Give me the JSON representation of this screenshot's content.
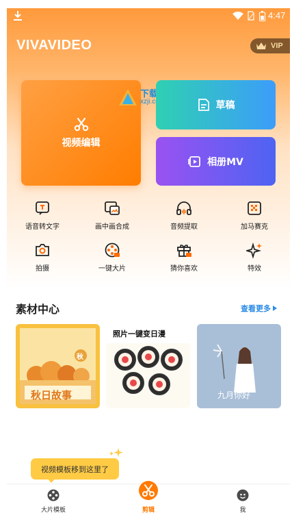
{
  "status_bar": {
    "time": "4:47"
  },
  "header": {
    "app_title": "VIVAVIDEO",
    "vip_label": "VIP"
  },
  "cards": {
    "edit_label": "视频编辑",
    "draft_label": "草稿",
    "mv_label": "相册MV"
  },
  "watermark": {
    "title": "下载集",
    "url": "xzji.com"
  },
  "tools": [
    {
      "label": "语音转文字",
      "icon": "speech-to-text-icon"
    },
    {
      "label": "画中画合成",
      "icon": "picture-in-picture-icon"
    },
    {
      "label": "音频提取",
      "icon": "headphones-icon"
    },
    {
      "label": "加马赛克",
      "icon": "mosaic-icon"
    },
    {
      "label": "拍摄",
      "icon": "camera-icon"
    },
    {
      "label": "一键大片",
      "icon": "film-reel-icon"
    },
    {
      "label": "猜你喜欢",
      "icon": "gift-icon"
    },
    {
      "label": "特效",
      "icon": "sparkle-icon"
    }
  ],
  "materials": {
    "section_title": "素材中心",
    "more_label": "查看更多",
    "thumbnails": [
      {
        "caption": "秋日故事",
        "badge": "秋"
      },
      {
        "caption": "照片一键变日漫"
      },
      {
        "caption": "九月你好"
      }
    ]
  },
  "tooltip": {
    "text": "视频模板移到这里了"
  },
  "bottom_nav": [
    {
      "label": "大片模板",
      "icon": "film-reel-icon"
    },
    {
      "label": "剪辑",
      "icon": "scissors-icon"
    },
    {
      "label": "我",
      "icon": "profile-icon"
    }
  ],
  "colors": {
    "accent": "#ff7d00",
    "link": "#2b8ce6",
    "tooltip": "#ffcb45"
  }
}
